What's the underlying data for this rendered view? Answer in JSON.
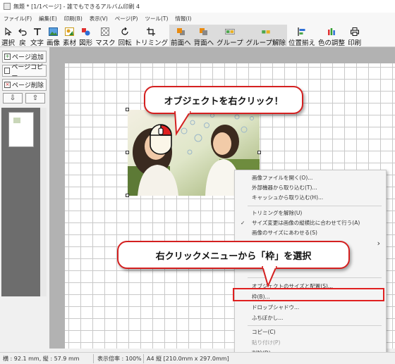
{
  "window": {
    "title": "無題 * [1/1ページ] - 誰でもできるアルバム印刷 4"
  },
  "menu": [
    "ファイル(F)",
    "編集(E)",
    "印刷(B)",
    "表示(V)",
    "ページ(P)",
    "ツール(T)",
    "情報(I)"
  ],
  "toolbar": [
    {
      "label": "選択",
      "icon": "cursor-icon"
    },
    {
      "label": "戻",
      "icon": "undo-icon"
    },
    {
      "label": "文字",
      "icon": "text-icon"
    },
    {
      "label": "画像",
      "icon": "image-icon"
    },
    {
      "label": "素材",
      "icon": "clipart-icon"
    },
    {
      "label": "図形",
      "icon": "shapes-icon"
    },
    {
      "label": "マスク",
      "icon": "mask-icon"
    },
    {
      "label": "回転",
      "icon": "rotate-icon"
    },
    {
      "label": "トリミング",
      "icon": "crop-icon"
    },
    {
      "label": "前面へ",
      "icon": "bring-front-icon"
    },
    {
      "label": "背面へ",
      "icon": "send-back-icon"
    },
    {
      "label": "グループ",
      "icon": "group-icon"
    },
    {
      "label": "グループ解除",
      "icon": "ungroup-icon"
    },
    {
      "label": "位置揃え",
      "icon": "align-icon"
    },
    {
      "label": "色の調整",
      "icon": "color-adjust-icon"
    },
    {
      "label": "印刷",
      "icon": "print-icon"
    }
  ],
  "sidebar": {
    "add_page": "ページ追加",
    "copy_page": "ページコピー",
    "delete_page": "ページ削除",
    "down_arrow": "⇩",
    "up_arrow": "⇧"
  },
  "callouts": {
    "top": "オブジェクトを右クリック！",
    "bottom": "右クリックメニューから「枠」を選択"
  },
  "context_menu": {
    "items": [
      {
        "label": "画像ファイルを開く(O)...",
        "disabled": false
      },
      {
        "label": "外部機器から取り込む(T)...",
        "disabled": false
      },
      {
        "label": "キャッシュから取り込む(H)...",
        "disabled": false
      },
      {
        "label": "トリミングを解除(U)",
        "disabled": false
      },
      {
        "label": "サイズ変更は画像の縦横比に合わせて行う(A)",
        "disabled": false,
        "checked": true
      },
      {
        "label": "画像のサイズにあわせる(S)",
        "disabled": false
      },
      {
        "label": "オブジェクトのサイズと配置(S)...",
        "disabled": false
      },
      {
        "label": "枠(B)...",
        "disabled": false,
        "highlighted": true
      },
      {
        "label": "ドロップシャドウ...",
        "disabled": false
      },
      {
        "label": "ふちぼかし...",
        "disabled": false
      },
      {
        "label": "コピー(C)",
        "disabled": false
      },
      {
        "label": "貼り付け(P)",
        "disabled": true
      },
      {
        "label": "削除(D)",
        "disabled": false
      }
    ],
    "check_mark": "✓",
    "submenu_arrow": "›"
  },
  "statusbar": {
    "size": "横 : 92.1 mm, 縦 : 57.9 mm",
    "zoom": "表示倍率 : 100%",
    "paper": "A4 縦 [210.0mm x 297.0mm]"
  },
  "colors": {
    "accent_red": "#d42020",
    "canvas_bg": "#b2b2b2"
  }
}
